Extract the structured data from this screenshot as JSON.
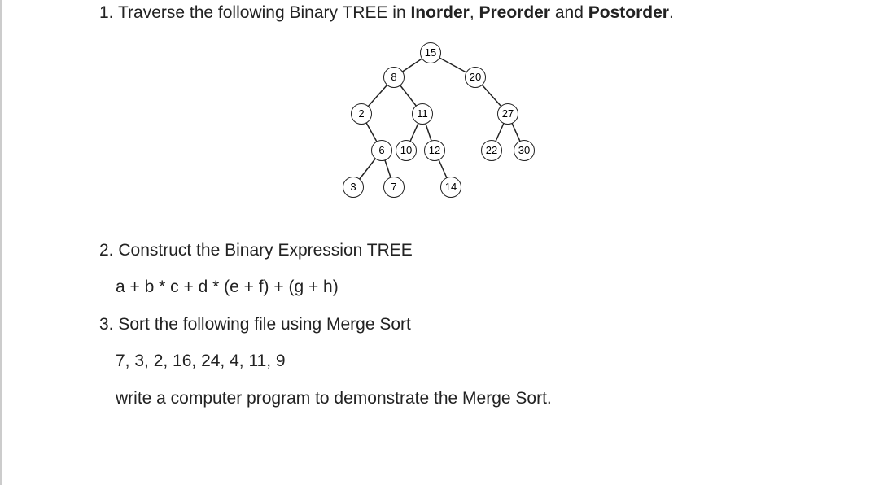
{
  "q1": {
    "number": "1.",
    "pre": "Traverse the following Binary TREE in ",
    "b1": "Inorder",
    "c1": ", ",
    "b2": "Preorder",
    "c2": " and ",
    "b3": "Postorder",
    "end": "."
  },
  "tree": {
    "n15": "15",
    "n8": "8",
    "n20": "20",
    "n2": "2",
    "n11": "11",
    "n27": "27",
    "n6": "6",
    "n10": "10",
    "n12": "12",
    "n22": "22",
    "n30": "30",
    "n3": "3",
    "n7": "7",
    "n14": "14"
  },
  "q2": {
    "number": "2.",
    "text": "Construct the Binary Expression TREE",
    "expr": "a + b * c + d * (e + f) + (g + h)"
  },
  "q3": {
    "number": "3.",
    "text": "Sort the following file using Merge Sort",
    "data": "7, 3, 2, 16, 24, 4, 11, 9",
    "prog": "write a computer program to demonstrate the Merge Sort."
  }
}
